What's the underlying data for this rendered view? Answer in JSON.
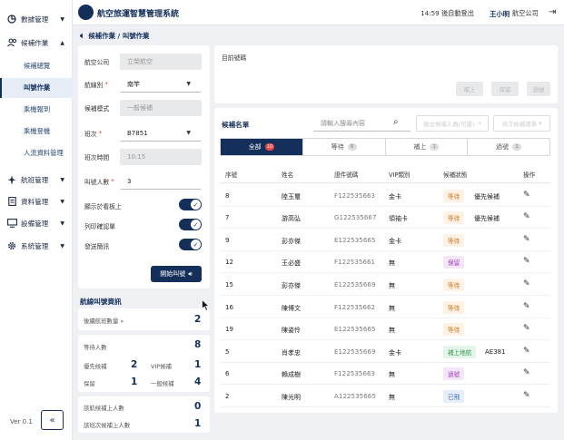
{
  "header": {
    "app_title": "航空旅運智慧管理系統",
    "time_text": "14:59 後自動登出",
    "user_name": "王小明",
    "company": "航空公司"
  },
  "sidebar": {
    "items": [
      {
        "label": "數據管理",
        "icon": "chart-icon"
      },
      {
        "label": "候補作業",
        "icon": "users-icon"
      },
      {
        "label": "航班管理",
        "icon": "plane-icon"
      },
      {
        "label": "資料管理",
        "icon": "document-icon"
      },
      {
        "label": "設備管理",
        "icon": "monitor-icon"
      },
      {
        "label": "系統管理",
        "icon": "gear-icon"
      }
    ],
    "sub_items": [
      {
        "label": "候補總覽"
      },
      {
        "label": "叫號作業"
      },
      {
        "label": "乘機報到"
      },
      {
        "label": "乘機登機"
      },
      {
        "label": "人流資料管理"
      }
    ],
    "version": "Ver 0.1"
  },
  "breadcrumb": "候補作業 / 叫號作業",
  "form": {
    "airline_label": "航空公司",
    "airline_value": "立榮航空",
    "route_label": "航線別",
    "route_value": "南竿",
    "mode_label": "候補模式",
    "mode_value": "一般候補",
    "flight_label": "班次",
    "flight_value": "B7851",
    "time_label": "班次時間",
    "time_value": "10:15",
    "count_label": "叫號人數",
    "count_value": "3",
    "toggle1": "顯示於看板上",
    "toggle2": "列印確認單",
    "toggle3": "發送簡訊",
    "start_button": "開始叫號"
  },
  "stats": {
    "title": "航線叫號資訊",
    "accum_label": "後續航班數量",
    "accum_value": "2",
    "waiting_label": "等待人數",
    "waiting_value": "8",
    "priority_label": "優先候補",
    "priority_value": "2",
    "vip_label": "VIP候補",
    "vip_value": "1",
    "hold_label": "保留",
    "hold_value": "1",
    "normal_label": "一般候補",
    "normal_value": "4",
    "boarded_label": "該航候補上人數",
    "boarded_value": "0",
    "prev_label": "該班次候補上人數",
    "prev_value": "1"
  },
  "current": {
    "label": "目前號碼",
    "btn1": "補上",
    "btn2": "保留",
    "btn3": "過號"
  },
  "list": {
    "title": "候補名單",
    "search_placeholder": "請輸入搜尋內容",
    "btn_a": "後台候補人員(可選)",
    "btn_b": "班次候補清單",
    "tabs": [
      {
        "label": "全部",
        "count": "10"
      },
      {
        "label": "等待",
        "count": "8"
      },
      {
        "label": "補上",
        "count": "1"
      },
      {
        "label": "過號",
        "count": "1"
      }
    ],
    "headers": [
      "序號",
      "姓名",
      "證件號碼",
      "VIP類別",
      "候補狀態",
      "操作"
    ],
    "rows": [
      {
        "no": "8",
        "name": "陸玉璽",
        "id": "F122535663",
        "vip": "金卡",
        "status": "等待",
        "status_type": "wait",
        "note": "優先候補"
      },
      {
        "no": "7",
        "name": "游高弘",
        "id": "G122535667",
        "vip": "領袖卡",
        "status": "等待",
        "status_type": "wait",
        "note": "優先候補"
      },
      {
        "no": "9",
        "name": "彭亦傑",
        "id": "E122535665",
        "vip": "金卡",
        "status": "等待",
        "status_type": "wait",
        "note": ""
      },
      {
        "no": "12",
        "name": "王必盛",
        "id": "F122535661",
        "vip": "無",
        "status": "保留",
        "status_type": "hold",
        "note": ""
      },
      {
        "no": "15",
        "name": "彭亦傑",
        "id": "E122535669",
        "vip": "無",
        "status": "等待",
        "status_type": "wait",
        "note": ""
      },
      {
        "no": "16",
        "name": "陳博文",
        "id": "F122535662",
        "vip": "無",
        "status": "等待",
        "status_type": "wait",
        "note": ""
      },
      {
        "no": "19",
        "name": "陳姿伶",
        "id": "E122535665",
        "vip": "無",
        "status": "等待",
        "status_type": "wait",
        "note": ""
      },
      {
        "no": "5",
        "name": "肖孝忠",
        "id": "E122535669",
        "vip": "金卡",
        "status": "補上地航",
        "status_type": "board",
        "note": "AE381"
      },
      {
        "no": "6",
        "name": "賴成樹",
        "id": "F122535663",
        "vip": "無",
        "status": "過號",
        "status_type": "hold",
        "note": ""
      },
      {
        "no": "2",
        "name": "陳光明",
        "id": "A122535665",
        "vip": "無",
        "status": "已飛",
        "status_type": "done",
        "note": ""
      }
    ]
  },
  "colors": {
    "primary": "#14305a",
    "wait": "#c87b2a",
    "hold": "#9a3fb5",
    "board": "#3a9a52",
    "done": "#3d6bb0"
  }
}
